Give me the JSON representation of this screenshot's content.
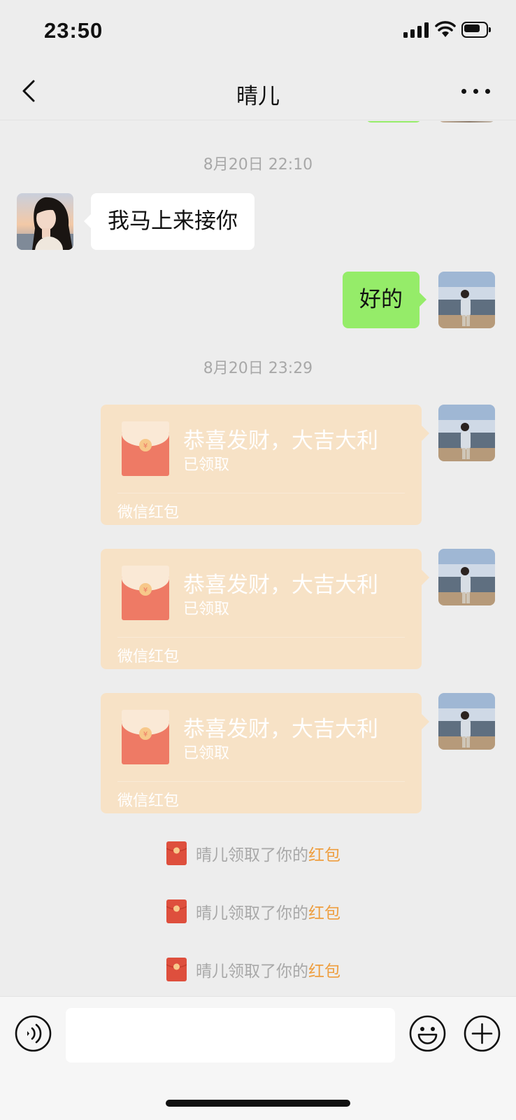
{
  "status_bar": {
    "time": "23:50"
  },
  "header": {
    "title": "晴儿",
    "back_icon": "chevron-left-icon",
    "more_icon": "more-horizontal-icon"
  },
  "messages": {
    "timestamp_1": "8月20日 22:10",
    "incoming_1": "我马上来接你",
    "outgoing_1": "好的",
    "timestamp_2": "8月20日 23:29"
  },
  "red_packets": [
    {
      "title": "恭喜发财，大吉大利",
      "status": "已领取",
      "footer": "微信红包"
    },
    {
      "title": "恭喜发财，大吉大利",
      "status": "已领取",
      "footer": "微信红包"
    },
    {
      "title": "恭喜发财，大吉大利",
      "status": "已领取",
      "footer": "微信红包"
    }
  ],
  "system_notices": [
    {
      "text": "晴儿领取了你的",
      "link": "红包"
    },
    {
      "text": "晴儿领取了你的",
      "link": "红包"
    },
    {
      "text": "晴儿领取了你的",
      "link": "红包"
    }
  ],
  "input_bar": {
    "text_value": "",
    "icons": [
      "voice-icon",
      "emoji-icon",
      "plus-icon"
    ]
  },
  "colors": {
    "background": "#ededed",
    "outgoing_bubble": "#95ec69",
    "incoming_bubble": "#ffffff",
    "red_packet_card": "#f7e2c6",
    "red_packet_envelope": "#ee7a65",
    "link": "#ee9e3f"
  }
}
